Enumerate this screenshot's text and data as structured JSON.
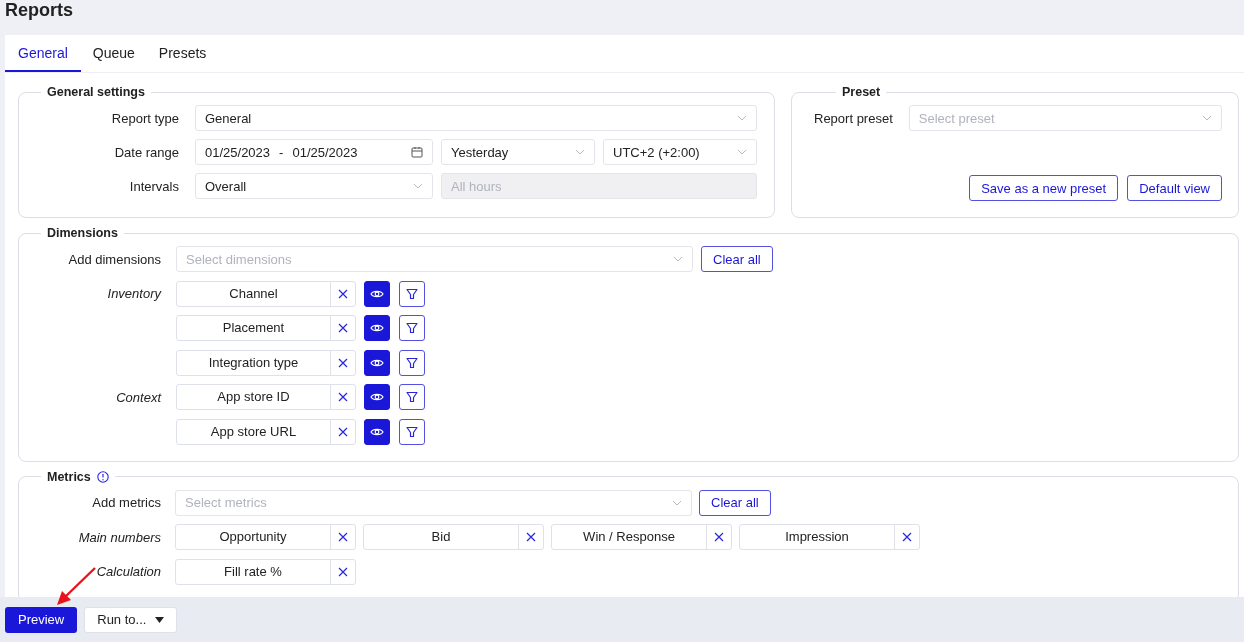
{
  "page_title": "Reports",
  "tabs": [
    {
      "label": "General",
      "selected": true
    },
    {
      "label": "Queue",
      "selected": false
    },
    {
      "label": "Presets",
      "selected": false
    }
  ],
  "general_settings": {
    "title": "General settings",
    "rows": [
      {
        "label": "Report type",
        "fields": [
          {
            "kind": "select",
            "value": "General"
          }
        ]
      },
      {
        "label": "Date range",
        "fields": [
          {
            "kind": "date",
            "start": "01/25/2023",
            "separator": "-",
            "end": "01/25/2023"
          },
          {
            "kind": "select",
            "value": "Yesterday"
          },
          {
            "kind": "select",
            "value": "UTC+2 (+2:00)"
          }
        ]
      },
      {
        "label": "Intervals",
        "fields": [
          {
            "kind": "select",
            "value": "Overall"
          },
          {
            "kind": "text",
            "placeholder": "All hours",
            "disabled": true
          }
        ]
      }
    ]
  },
  "preset": {
    "title": "Preset",
    "label": "Report preset",
    "placeholder": "Select preset",
    "buttons": [
      "Save as a new preset",
      "Default view"
    ]
  },
  "dimensions": {
    "title": "Dimensions",
    "add_label": "Add dimensions",
    "placeholder": "Select dimensions",
    "clear_label": "Clear all",
    "groups": [
      {
        "label": "Inventory",
        "items": [
          {
            "name": "Channel",
            "visible": true
          },
          {
            "name": "Placement",
            "visible": true
          },
          {
            "name": "Integration type",
            "visible": true
          }
        ]
      },
      {
        "label": "Context",
        "items": [
          {
            "name": "App store ID",
            "visible": true
          },
          {
            "name": "App store URL",
            "visible": true
          }
        ]
      }
    ]
  },
  "metrics": {
    "title": "Metrics",
    "add_label": "Add metrics",
    "placeholder": "Select metrics",
    "clear_label": "Clear all",
    "groups": [
      {
        "label": "Main numbers",
        "items": [
          {
            "name": "Opportunity"
          },
          {
            "name": "Bid"
          },
          {
            "name": "Win / Response"
          },
          {
            "name": "Impression"
          }
        ]
      },
      {
        "label": "Calculation",
        "items": [
          {
            "name": "Fill rate %"
          }
        ]
      }
    ]
  },
  "footer": {
    "primary": "Preview",
    "secondary": "Run to..."
  }
}
